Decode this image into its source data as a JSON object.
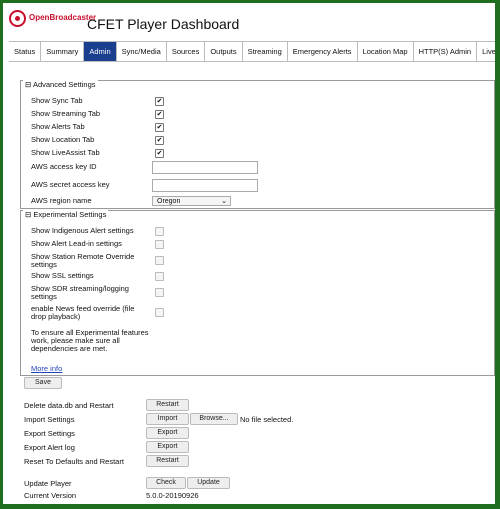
{
  "app": {
    "brand": "OpenBroadcaster",
    "title": "CFET Player Dashboard"
  },
  "tabs": [
    "Status",
    "Summary",
    "Admin",
    "Sync/Media",
    "Sources",
    "Outputs",
    "Streaming",
    "Emergency Alerts",
    "Location Map",
    "HTTP(S) Admin",
    "Live Assist"
  ],
  "active_tab": "Admin",
  "advanced": {
    "legend": "⊟ Advanced Settings",
    "checks": [
      {
        "label": "Show Sync Tab",
        "checked": true
      },
      {
        "label": "Show Streaming Tab",
        "checked": true
      },
      {
        "label": "Show Alerts Tab",
        "checked": true
      },
      {
        "label": "Show Location Tab",
        "checked": true
      },
      {
        "label": "Show LiveAssist Tab",
        "checked": true
      }
    ],
    "aws_key_label": "AWS access key ID",
    "aws_key_value": "",
    "aws_secret_label": "AWS secret access key",
    "aws_secret_value": "",
    "aws_region_label": "AWS region name",
    "aws_region_value": "Oregon"
  },
  "experimental": {
    "legend": "⊟ Experimental Settings",
    "checks": [
      {
        "label": "Show Indigenous Alert settings",
        "checked": false
      },
      {
        "label": "Show Alert Lead-in settings",
        "checked": false
      },
      {
        "label": "Show Station Remote Override settings",
        "checked": false
      },
      {
        "label": "Show SSL settings",
        "checked": false
      },
      {
        "label": "Show SDR streaming/logging settings",
        "checked": false
      },
      {
        "label": "enable News feed override (file drop playback)",
        "checked": false
      }
    ],
    "note": "To ensure all Experimental features work, please make sure all dependencies are met.",
    "more_info": "More info"
  },
  "save_label": "Save",
  "actions": {
    "delete_db_label": "Delete data.db and Restart",
    "restart_label": "Restart",
    "import_label": "Import Settings",
    "import_btn": "Import",
    "browse_btn": "Browse...",
    "no_file": "No file selected.",
    "export_label": "Export Settings",
    "export_btn": "Export",
    "export_alert_label": "Export Alert log",
    "export_alert_btn": "Export",
    "reset_label": "Reset To Defaults and Restart",
    "reset_btn": "Restart"
  },
  "update": {
    "label": "Update Player",
    "check_btn": "Check",
    "update_btn": "Update",
    "version_label": "Current Version",
    "version_value": "5.0.0-20190926"
  }
}
